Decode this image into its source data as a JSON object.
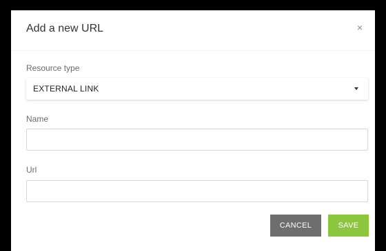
{
  "dialog": {
    "title": "Add a new URL",
    "close_glyph": "×"
  },
  "resource_type": {
    "label": "Resource type",
    "selected": "EXTERNAL LINK"
  },
  "name_field": {
    "label": "Name",
    "value": "",
    "placeholder": ""
  },
  "url_field": {
    "label": "Url",
    "value": "",
    "placeholder": ""
  },
  "actions": {
    "cancel_label": "CANCEL",
    "save_label": "SAVE"
  },
  "colors": {
    "cancel_bg": "#6e6e6e",
    "save_bg": "#8cc63f",
    "frame": "#000000"
  },
  "icons": {
    "close": "close-icon",
    "dropdown": "caret-down-icon"
  }
}
